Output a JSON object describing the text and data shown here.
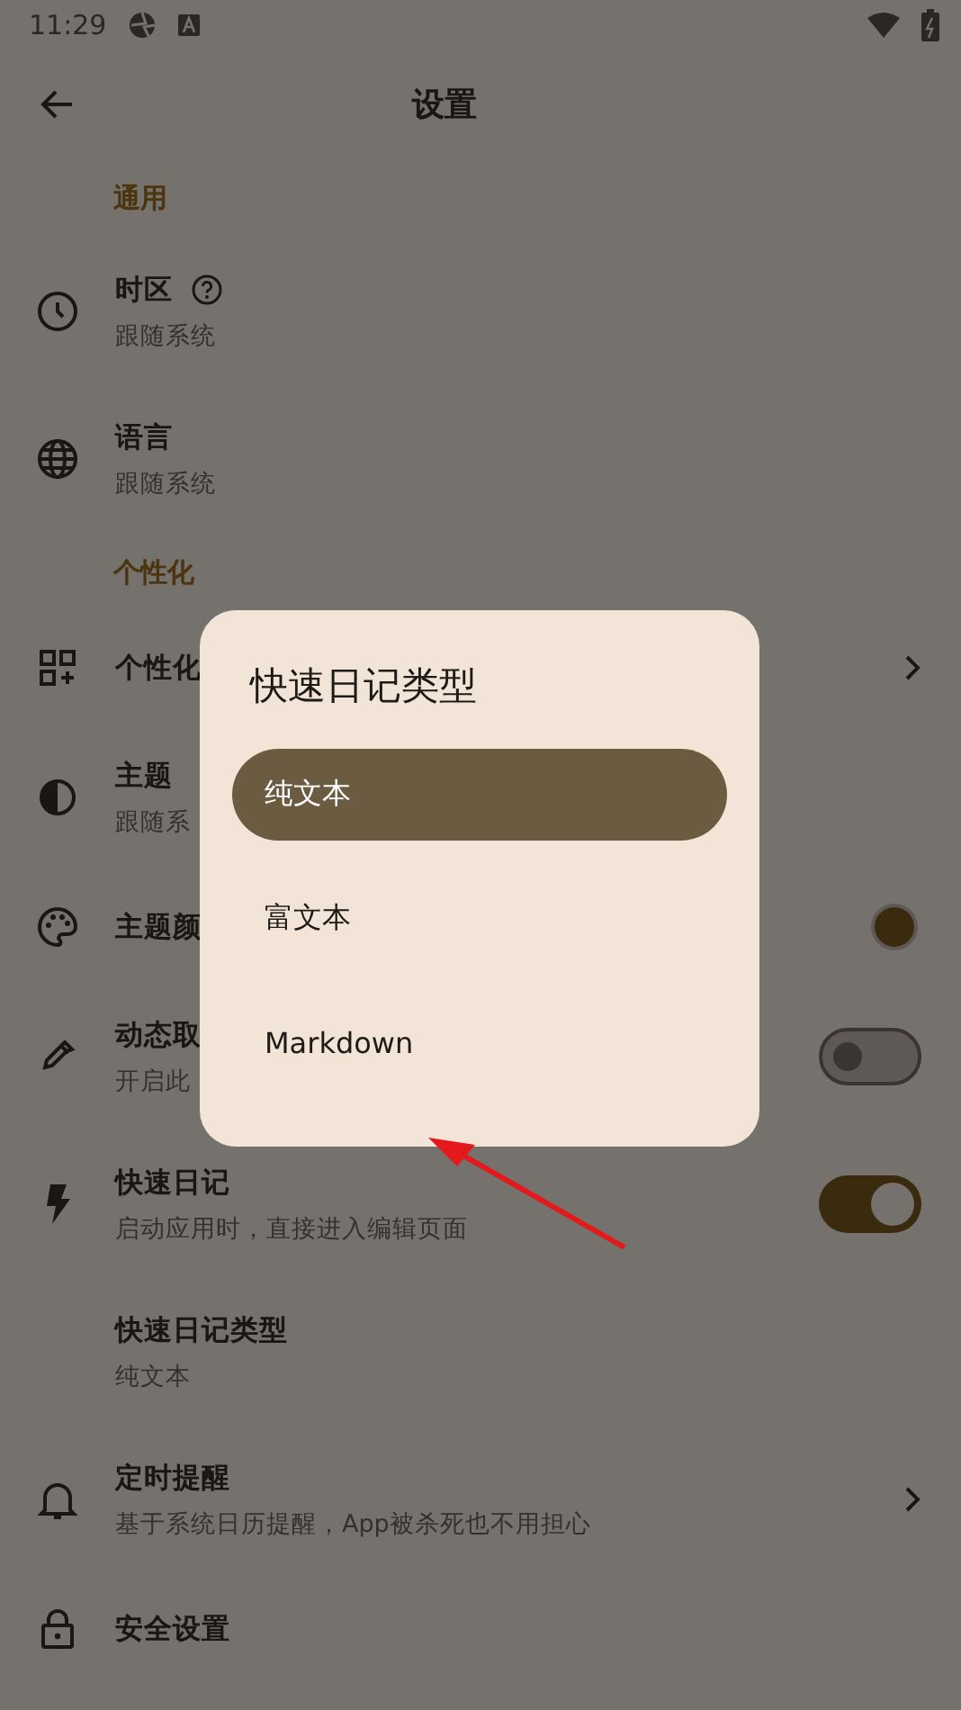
{
  "status_bar": {
    "time": "11:29"
  },
  "app_bar": {
    "title": "设置"
  },
  "sections": [
    {
      "header": "通用",
      "items": [
        {
          "title": "时区",
          "help": true,
          "subtitle": "跟随系统"
        },
        {
          "title": "语言",
          "subtitle": "跟随系统"
        }
      ]
    },
    {
      "header": "个性化",
      "items": [
        {
          "title": "个性化",
          "trailing": {
            "kind": "chevron"
          }
        },
        {
          "title": "主题",
          "subtitle": "跟随系"
        },
        {
          "title": "主题颜",
          "trailing": {
            "kind": "color",
            "color": "#3a2a0e"
          }
        },
        {
          "title": "动态取",
          "subtitle": "开启此",
          "trailing": {
            "kind": "switch",
            "on": false
          }
        },
        {
          "title": "快速日记",
          "subtitle": "启动应用时，直接进入编辑页面",
          "trailing": {
            "kind": "switch",
            "on": true
          }
        },
        {
          "title": "快速日记类型",
          "subtitle": "纯文本"
        },
        {
          "title": "定时提醒",
          "subtitle": "基于系统日历提醒，App被杀死也不用担心",
          "trailing": {
            "kind": "chevron"
          }
        },
        {
          "title": "安全设置"
        }
      ]
    }
  ],
  "dialog": {
    "title": "快速日记类型",
    "options": [
      {
        "label": "纯文本",
        "selected": true
      },
      {
        "label": "富文本",
        "selected": false
      },
      {
        "label": "Markdown",
        "selected": false
      }
    ]
  }
}
